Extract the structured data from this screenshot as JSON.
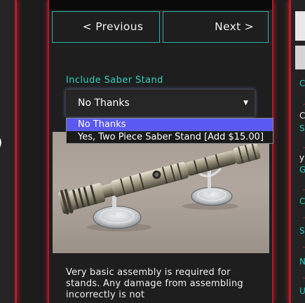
{
  "nav": {
    "previous_label": "< Previous",
    "next_label": "Next >"
  },
  "stand_field": {
    "label": "Include Saber Stand",
    "selected_value": "No Thanks",
    "arrow_icon": "triangle-down-icon",
    "options": [
      "No Thanks",
      "Yes, Two Piece Saber Stand [Add $15.00]"
    ]
  },
  "description": "Very basic assembly is required for stands. Any damage from assembling incorrectly is not",
  "left_panel": {
    "edge_char": ")"
  },
  "right_panel": {
    "letters": [
      "C",
      "C",
      "S",
      "y",
      "G",
      "C",
      "S",
      "N",
      "U"
    ]
  },
  "colors": {
    "accent_teal": "#2fd0bc",
    "neon_red": "#c01a2a",
    "selected_option": "#5a5af2",
    "background": "#1e1e1e"
  }
}
